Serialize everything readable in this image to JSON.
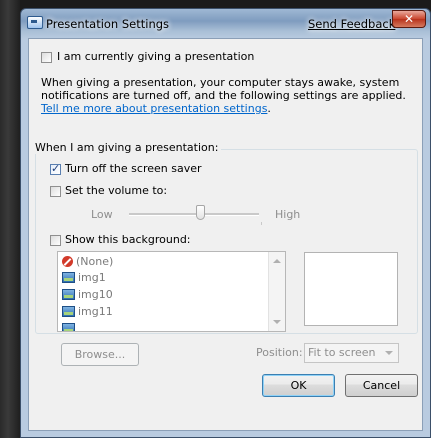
{
  "window": {
    "title": "Presentation Settings",
    "feedback_link": "Send Feedback",
    "close_glyph": "✕"
  },
  "presenting": {
    "checkbox_label": "I am currently giving a presentation",
    "checked": false,
    "description_line1": "When giving a presentation, your computer stays awake, system",
    "description_line2": "notifications are turned off, and the following settings are applied.",
    "help_link": "Tell me more about presentation settings",
    "help_link_suffix": "."
  },
  "group": {
    "title": "When I am giving a presentation:",
    "screen_saver": {
      "label": "Turn off the screen saver",
      "checked": true
    },
    "volume": {
      "label": "Set the volume to:",
      "checked": false,
      "low_label": "Low",
      "high_label": "High",
      "level": 0.55
    },
    "background": {
      "label": "Show this background:",
      "checked": false,
      "items": [
        {
          "label": "(None)",
          "icon": "none-icon"
        },
        {
          "label": "img1",
          "icon": "image-icon"
        },
        {
          "label": "img10",
          "icon": "image-icon"
        },
        {
          "label": "img11",
          "icon": "image-icon"
        }
      ],
      "browse_label": "Browse...",
      "position_label": "Position:",
      "position_value": "Fit to screen"
    }
  },
  "buttons": {
    "ok": "OK",
    "cancel": "Cancel"
  }
}
